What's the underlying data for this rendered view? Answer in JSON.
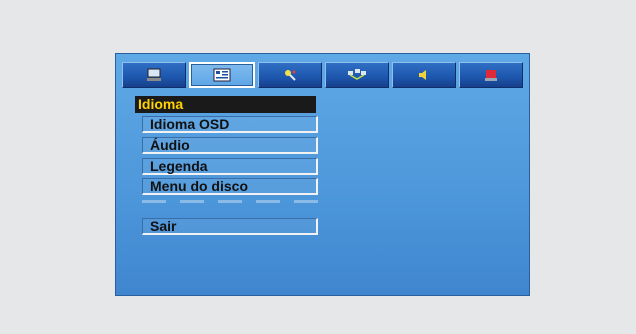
{
  "tabs": [
    {
      "icon": "monitor-icon",
      "active": false
    },
    {
      "icon": "language-settings-icon",
      "active": true
    },
    {
      "icon": "video-settings-icon",
      "active": false
    },
    {
      "icon": "network-icon",
      "active": false
    },
    {
      "icon": "speaker-icon",
      "active": false
    },
    {
      "icon": "flag-exit-icon",
      "active": false
    }
  ],
  "menu": {
    "header": "Idioma",
    "items": [
      "Idioma OSD",
      "Áudio",
      "Legenda",
      "Menu do disco"
    ],
    "exit": "Sair"
  },
  "colors": {
    "screen_bg": "#4e98db",
    "header_text": "#ffd200",
    "header_bg": "#1a1a1a"
  }
}
